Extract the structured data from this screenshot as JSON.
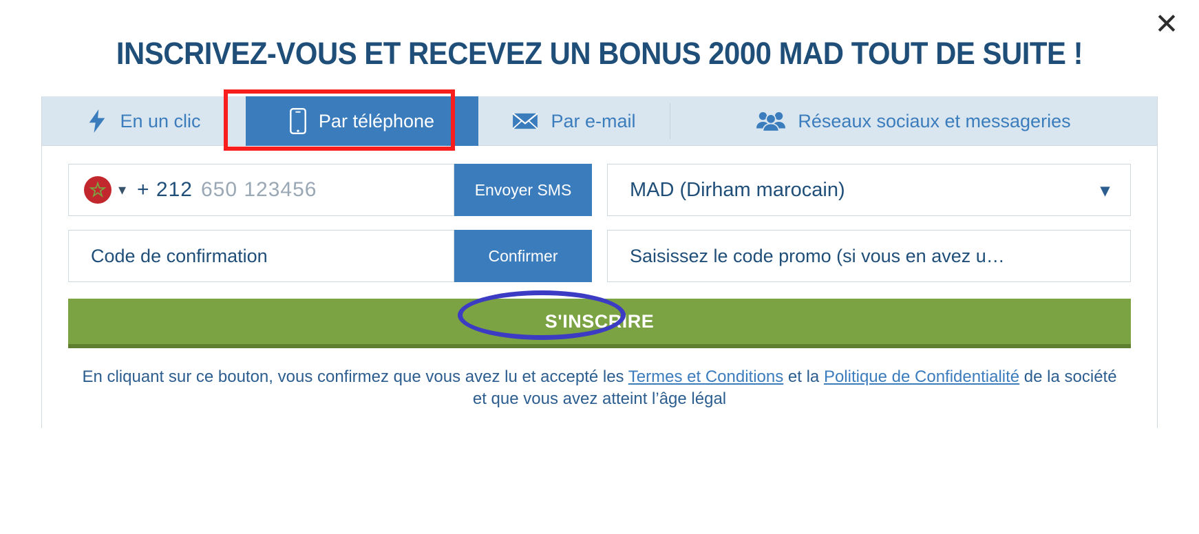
{
  "header": {
    "title": "INSCRIVEZ-VOUS ET RECEVEZ UN BONUS 2000 MAD TOUT DE SUITE !",
    "close_label": "✕",
    "close_icon": "close-icon"
  },
  "tabs": [
    {
      "label": "En un clic",
      "icon": "lightning-bolt-icon",
      "active": false
    },
    {
      "label": "Par téléphone",
      "icon": "mobile-phone-icon",
      "active": true
    },
    {
      "label": "Par e-mail",
      "icon": "envelope-icon",
      "active": false
    },
    {
      "label": "Réseaux sociaux et messageries",
      "icon": "people-group-icon",
      "active": false
    }
  ],
  "form": {
    "phone": {
      "country_flag": "morocco-flag-icon",
      "dial_code": "+ 212",
      "placeholder": "650 123456",
      "value": "",
      "send_sms_label": "Envoyer SMS"
    },
    "currency": {
      "selected": "MAD (Dirham marocain)",
      "caret_icon": "chevron-down-icon"
    },
    "confirmation": {
      "placeholder": "Code de confirmation",
      "value": "",
      "confirm_label": "Confirmer"
    },
    "promo": {
      "placeholder": "Saisissez le code promo (si vous en avez u…",
      "value": ""
    },
    "submit_label": "S'INSCRIRE"
  },
  "footer": {
    "text_before": "En cliquant sur ce bouton, vous confirmez que vous avez lu et accepté les ",
    "link_terms": "Termes et Conditions",
    "text_middle": " et la ",
    "link_privacy": "Politique de Confidentialité",
    "text_after": " de la société et que vous avez atteint l’âge légal"
  },
  "annotations": {
    "tab_highlight_color": "#f81e1e",
    "submit_highlight_color": "#3b3bc4"
  },
  "colors": {
    "brand_blue": "#3b7cbd",
    "title_navy": "#1f4e79",
    "tab_bar": "#d9e6ef",
    "submit_green": "#7ba343",
    "submit_green_dark": "#5e7f30",
    "flag_red": "#c1272d",
    "flag_green": "#7ba343"
  }
}
